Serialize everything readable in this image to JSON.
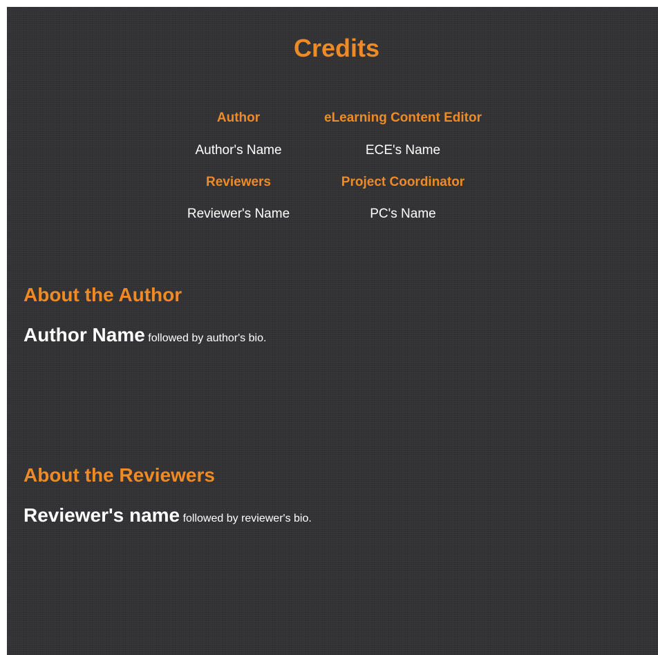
{
  "page": {
    "title": "Credits"
  },
  "credits": {
    "author_label": "Author",
    "author_name": "Author's Name",
    "ece_label": "eLearning Content Editor",
    "ece_name": "ECE's Name",
    "reviewers_label": "Reviewers",
    "reviewers_name": "Reviewer's Name",
    "pc_label": "Project Coordinator",
    "pc_name": "PC's Name"
  },
  "about_author": {
    "heading": "About the Author",
    "name": "Author Name",
    "bio": "followed by author's bio."
  },
  "about_reviewers": {
    "heading": "About the Reviewers",
    "name": "Reviewer's name",
    "bio": "followed by reviewer's bio."
  },
  "colors": {
    "accent": "#f08a24",
    "background": "#333335",
    "text": "#ffffff"
  }
}
